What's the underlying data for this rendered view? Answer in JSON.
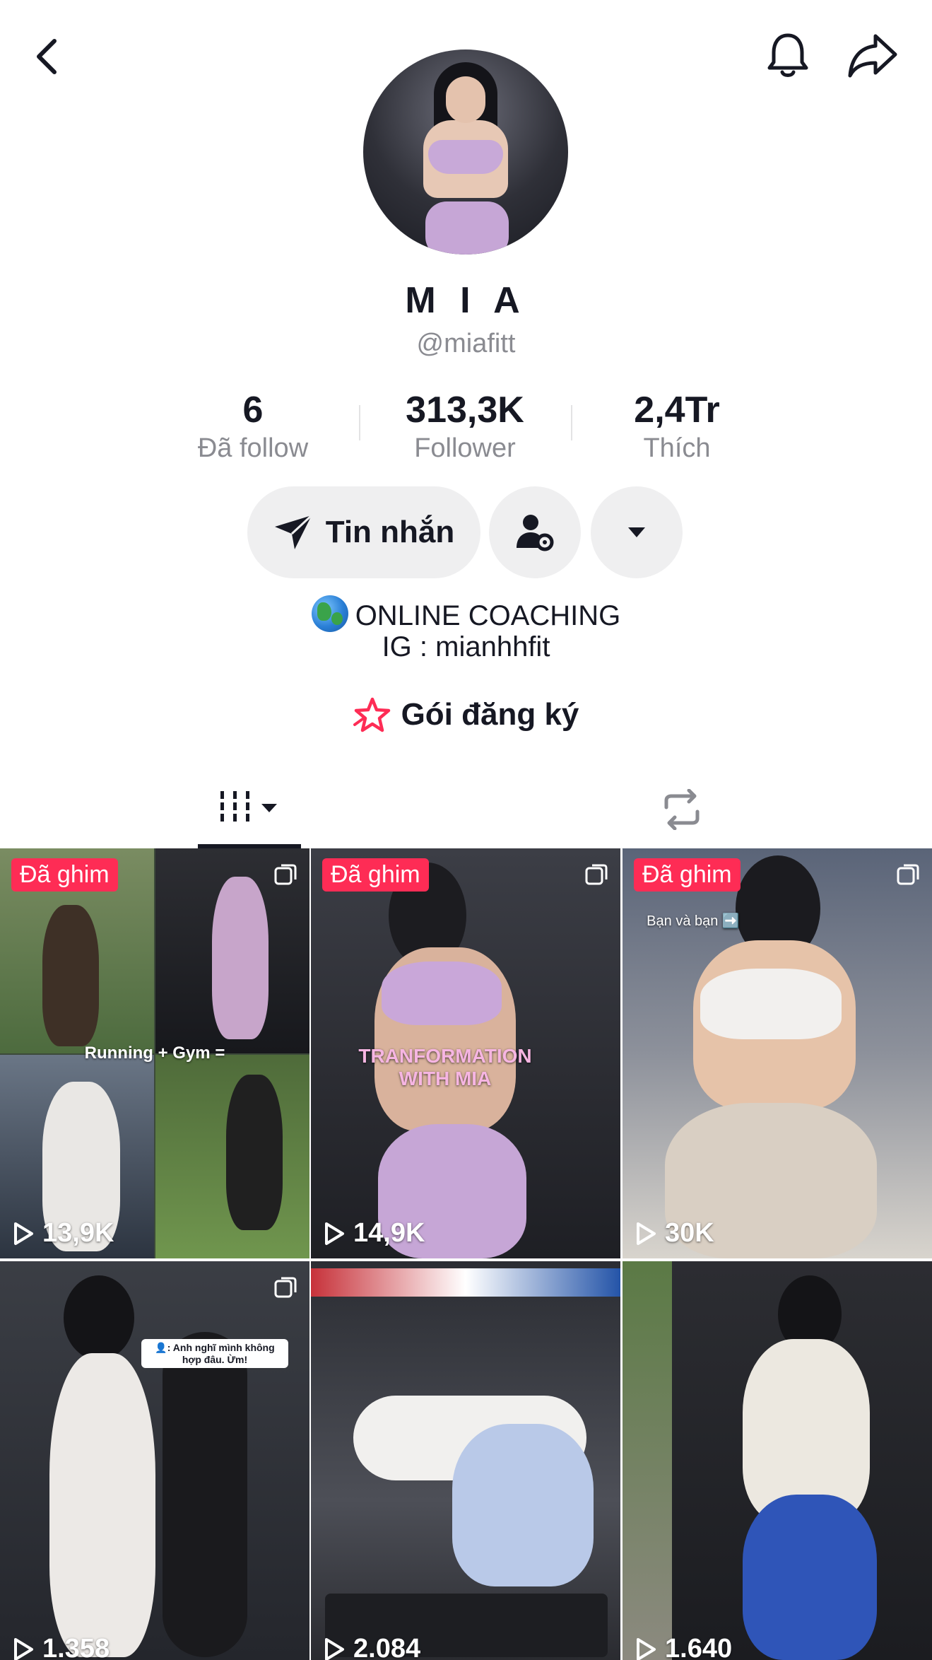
{
  "profile": {
    "name": "M I A",
    "handle": "@miafitt"
  },
  "stats": {
    "following": {
      "value": "6",
      "label": "Đã follow"
    },
    "followers": {
      "value": "313,3K",
      "label": "Follower"
    },
    "likes": {
      "value": "2,4Tr",
      "label": "Thích"
    }
  },
  "actions": {
    "message_label": "Tin nhắn"
  },
  "bio": {
    "line1": "ONLINE COACHING",
    "line2": "IG : mianhhfit"
  },
  "subscription": {
    "label": "Gói đăng ký"
  },
  "icons": {
    "back": "chevron-left-icon",
    "bell": "bell-icon",
    "share": "share-icon",
    "send": "send-icon",
    "friend": "user-settings-icon",
    "more": "caret-down-icon",
    "globe": "globe-icon",
    "star": "star-icon",
    "grid": "grid-icon",
    "repost": "repost-icon",
    "play": "play-icon"
  },
  "colors": {
    "accent": "#fe2c55",
    "text": "#161823",
    "secondary": "#8a8b91"
  },
  "videos": [
    {
      "pinned": "Đã ghim",
      "views": "13,9K",
      "overlay": "Running + Gym ="
    },
    {
      "pinned": "Đã ghim",
      "views": "14,9K",
      "overlay": "TRANFORMATION WITH MIA"
    },
    {
      "pinned": "Đã ghim",
      "views": "30K",
      "overlay": "Bạn và bạn ➡️"
    },
    {
      "views": "1.358",
      "overlay": "👤: Anh nghĩ mình không hợp đâu. Ừm!"
    },
    {
      "views": "2.084"
    },
    {
      "views": "1.640"
    }
  ]
}
